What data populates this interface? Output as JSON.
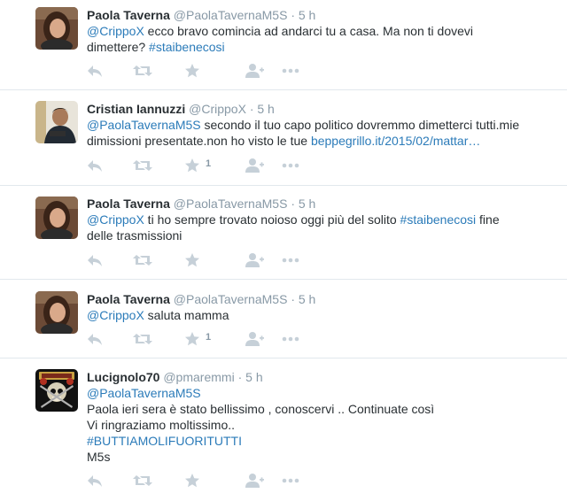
{
  "tweets": [
    {
      "fullname": "Paola Taverna",
      "username": "@PaolaTavernaM5S",
      "separator": "·",
      "time": "5 h",
      "avatar_icon": "profile-photo-woman",
      "lines": [
        [
          {
            "t": "@CrippoX",
            "link": true
          },
          {
            "t": " ecco bravo comincia ad andarci tu a casa. Ma non ti dovevi"
          }
        ],
        [
          {
            "t": "dimettere? "
          },
          {
            "t": "#staibenecosi",
            "link": true
          }
        ]
      ],
      "favorite_count": ""
    },
    {
      "fullname": "Cristian Iannuzzi",
      "username": "@CrippoX",
      "separator": "·",
      "time": "5 h",
      "avatar_icon": "profile-photo-man",
      "lines": [
        [
          {
            "t": "@PaolaTavernaM5S",
            "link": true
          },
          {
            "t": " secondo il tuo capo politico dovremmo dimetterci tutti.mie"
          }
        ],
        [
          {
            "t": "dimissioni presentate.non ho visto le tue "
          },
          {
            "t": "beppegrillo.it/2015/02/mattar…",
            "link": true
          }
        ]
      ],
      "favorite_count": "1"
    },
    {
      "fullname": "Paola Taverna",
      "username": "@PaolaTavernaM5S",
      "separator": "·",
      "time": "5 h",
      "avatar_icon": "profile-photo-woman",
      "lines": [
        [
          {
            "t": "@CrippoX",
            "link": true
          },
          {
            "t": " ti ho sempre trovato noioso oggi più del solito "
          },
          {
            "t": "#staibenecosi",
            "link": true
          },
          {
            "t": " fine"
          }
        ],
        [
          {
            "t": "delle trasmissioni"
          }
        ]
      ],
      "favorite_count": ""
    },
    {
      "fullname": "Paola Taverna",
      "username": "@PaolaTavernaM5S",
      "separator": "·",
      "time": "5 h",
      "avatar_icon": "profile-photo-woman",
      "lines": [
        [
          {
            "t": "@CrippoX",
            "link": true
          },
          {
            "t": " saluta mamma"
          }
        ]
      ],
      "favorite_count": "1"
    },
    {
      "fullname": "Lucignolo70",
      "username": "@pmaremmi",
      "separator": "·",
      "time": "5 h",
      "avatar_icon": "guns-n-roses-logo",
      "lines": [
        [
          {
            "t": "@PaolaTavernaM5S",
            "link": true
          }
        ],
        [
          {
            "t": "Paola ieri sera è stato bellissimo , conoscervi .. Continuate così"
          }
        ],
        [
          {
            "t": "Vi ringraziamo moltissimo.."
          }
        ],
        [
          {
            "t": "#BUTTIAMOLIFUORITUTTI",
            "link": true
          }
        ],
        [
          {
            "t": "M5s"
          }
        ]
      ],
      "favorite_count": ""
    }
  ],
  "action_icons": [
    "reply-icon",
    "retweet-icon",
    "favorite-icon",
    "follow-icon",
    "more-icon"
  ],
  "colors": {
    "link": "#2b7bb9",
    "secondary": "#8899a6",
    "icon": "#c6d0d8",
    "divider": "#e1e8ed"
  }
}
